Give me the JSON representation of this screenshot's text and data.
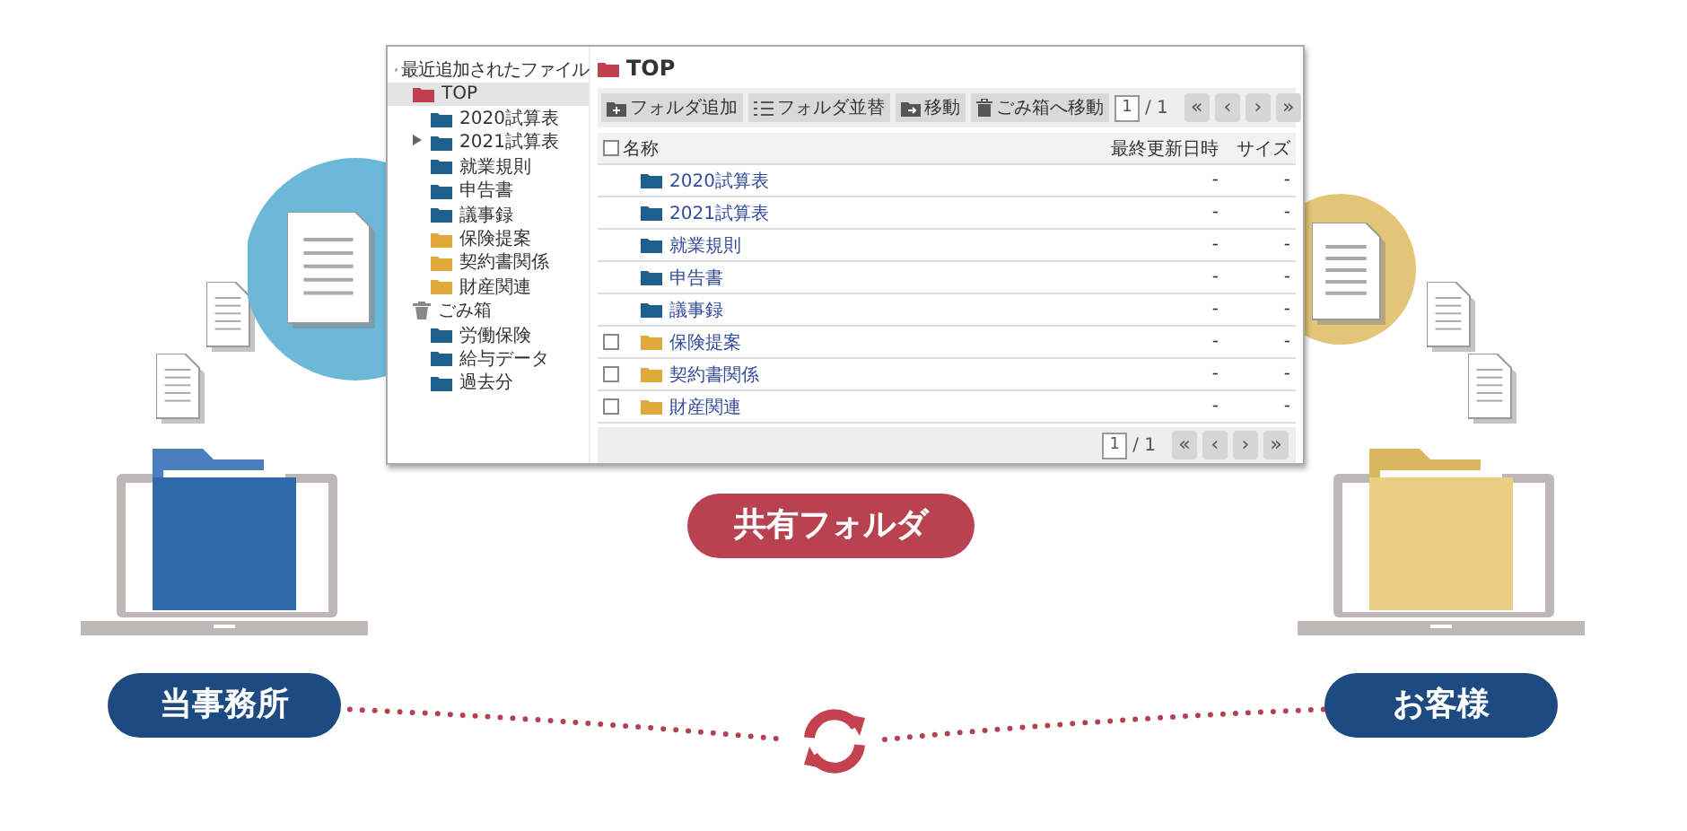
{
  "window": {
    "sidebar": {
      "recent": "最近追加されたファイル",
      "tree": [
        {
          "label": "TOP",
          "kind": "folder",
          "color": "#c0404f",
          "selected": true,
          "expanded": true,
          "children": [
            {
              "label": "2020試算表",
              "kind": "folder",
              "color": "#1f5f8b",
              "selected": false
            },
            {
              "label": "2021試算表",
              "kind": "folder",
              "color": "#1f5f8b",
              "selected": false,
              "expanded": false
            },
            {
              "label": "就業規則",
              "kind": "folder",
              "color": "#1f5f8b",
              "selected": false
            },
            {
              "label": "申告書",
              "kind": "folder",
              "color": "#1f5f8b",
              "selected": false
            },
            {
              "label": "議事録",
              "kind": "folder",
              "color": "#1f5f8b",
              "selected": false
            },
            {
              "label": "保険提案",
              "kind": "folder",
              "color": "#e0a93c",
              "selected": false
            },
            {
              "label": "契約書関係",
              "kind": "folder",
              "color": "#e0a93c",
              "selected": false
            },
            {
              "label": "財産関連",
              "kind": "folder",
              "color": "#e0a93c",
              "selected": false
            }
          ]
        },
        {
          "label": "ごみ箱",
          "kind": "trash",
          "color": "#888888",
          "selected": false,
          "expanded": true,
          "children": [
            {
              "label": "労働保険",
              "kind": "folder",
              "color": "#1f5f8b",
              "selected": false
            },
            {
              "label": "給与データ",
              "kind": "folder",
              "color": "#1f5f8b",
              "selected": false
            },
            {
              "label": "過去分",
              "kind": "folder",
              "color": "#1f5f8b",
              "selected": false
            }
          ]
        }
      ]
    },
    "title": "TOP",
    "toolbar": [
      {
        "label": "フォルダ追加",
        "kind": "add"
      },
      {
        "label": "フォルダ並替",
        "kind": "sort"
      },
      {
        "label": "移動",
        "kind": "move"
      },
      {
        "label": "ごみ箱へ移動",
        "kind": "trash"
      }
    ],
    "pager_top": {
      "page": "1",
      "total": "/ 1",
      "buttons": [
        "«",
        "‹",
        "›",
        "»"
      ]
    },
    "table": {
      "header_checked": false,
      "columns": [
        "名称",
        "最終更新日時",
        "サイズ"
      ],
      "rows": [
        {
          "name": "2020試算表",
          "color": "#1f5f8b",
          "kind": "fixed",
          "date": "-",
          "size": "-"
        },
        {
          "name": "2021試算表",
          "color": "#1f5f8b",
          "kind": "fixed",
          "date": "-",
          "size": "-"
        },
        {
          "name": "就業規則",
          "color": "#1f5f8b",
          "kind": "fixed",
          "date": "-",
          "size": "-"
        },
        {
          "name": "申告書",
          "color": "#1f5f8b",
          "kind": "fixed",
          "date": "-",
          "size": "-"
        },
        {
          "name": "議事録",
          "color": "#1f5f8b",
          "kind": "fixed",
          "date": "-",
          "size": "-"
        },
        {
          "name": "保険提案",
          "color": "#e0a93c",
          "kind": "selectable",
          "checked": false,
          "date": "-",
          "size": "-"
        },
        {
          "name": "契約書関係",
          "color": "#e0a93c",
          "kind": "selectable",
          "checked": false,
          "date": "-",
          "size": "-"
        },
        {
          "name": "財産関連",
          "color": "#e0a93c",
          "kind": "selectable",
          "checked": false,
          "date": "-",
          "size": "-"
        }
      ]
    },
    "pager_bottom": {
      "page": "1",
      "total": "/ 1",
      "buttons": [
        "«",
        "‹",
        "›",
        "»"
      ]
    }
  },
  "shared_label": "共有フォルダ",
  "office_label": "当事務所",
  "client_label": "お客様"
}
